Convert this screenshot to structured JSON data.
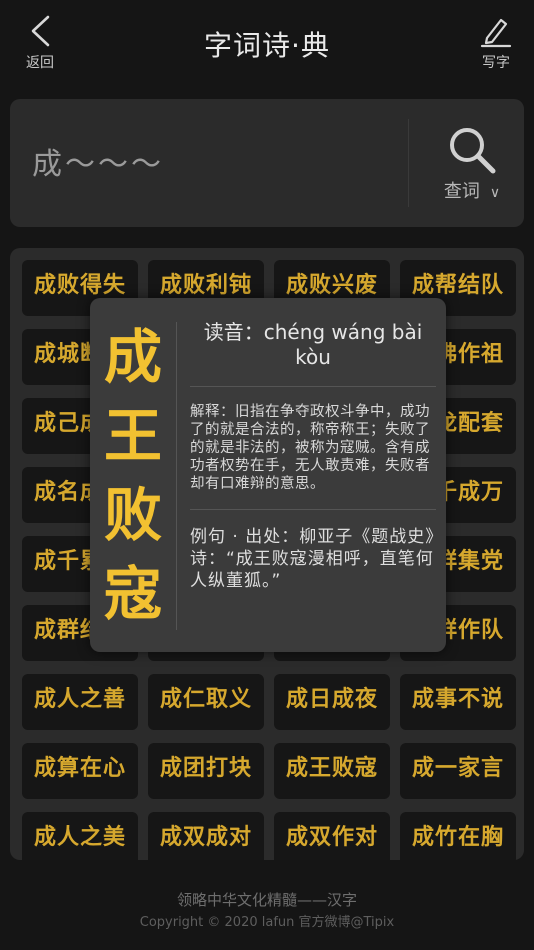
{
  "header": {
    "back_label": "返回",
    "title": "字词诗·典",
    "write_label": "写字"
  },
  "search": {
    "value": "成～～～",
    "button_label": "查词",
    "dropdown_icon": "chevron-down-icon"
  },
  "grid": {
    "items": [
      "成败得失",
      "成败利钝",
      "成败兴废",
      "成帮结队",
      "成城断金",
      "",
      "",
      "成佛作祖",
      "成己成物",
      "",
      "",
      "成龙配套",
      "成名成家",
      "",
      "",
      "成千成万",
      "成千累万",
      "",
      "",
      "成群集党",
      "成群结队",
      "",
      "",
      "成群作队",
      "成人之善",
      "成仁取义",
      "成日成夜",
      "成事不说",
      "成算在心",
      "成团打块",
      "成王败寇",
      "成一家言",
      "成人之美",
      "成双成对",
      "成双作对",
      "成竹在胸"
    ]
  },
  "modal": {
    "characters": [
      "成",
      "王",
      "败",
      "寇"
    ],
    "pronunciation": "读音：chéng wáng bài kòu",
    "explanation": "解释：旧指在争夺政权斗争中，成功了的就是合法的，称帝称王；失败了的就是非法的，被称为寇贼。含有成功者权势在手，无人敢责难，失败者却有口难辩的意思。",
    "example": "例句 · 出处：柳亚子《题战史》诗：“成王败寇漫相呼，直笔何人纵董狐。”"
  },
  "footer": {
    "line1": "领略中华文化精髓——汉字",
    "line2": "Copyright © 2020  lafun 官方微博@Tipix"
  },
  "colors": {
    "accent": "#f2c131",
    "grid_text": "#d6a82e",
    "background": "#151515",
    "panel": "#2b2b2b"
  }
}
